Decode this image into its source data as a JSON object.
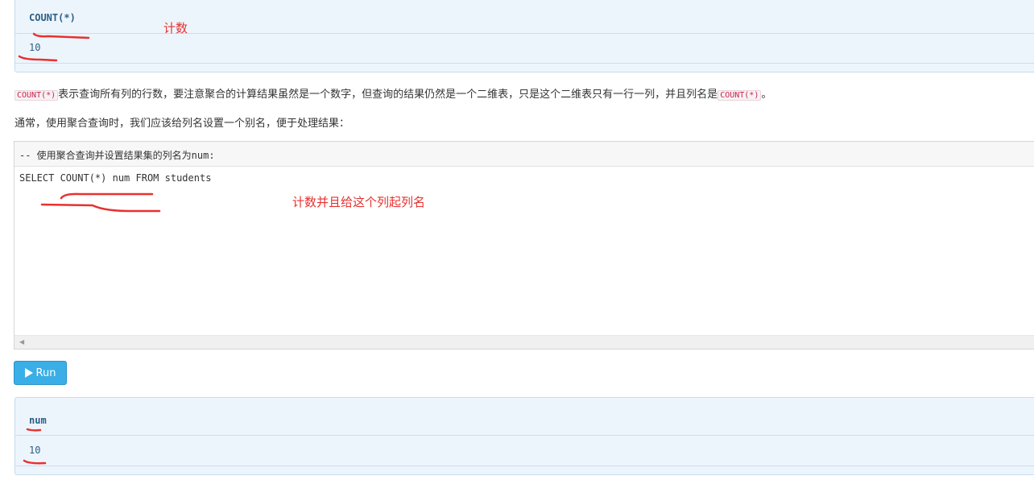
{
  "result_top": {
    "header": "COUNT(*)",
    "value": "10"
  },
  "paragraph1": {
    "code1": "COUNT(*)",
    "text": "表示查询所有列的行数，要注意聚合的计算结果虽然是一个数字，但查询的结果仍然是一个二维表，只是这个二维表只有一行一列，并且列名是",
    "code2": "COUNT(*)",
    "end": "。"
  },
  "paragraph2": {
    "text": "通常，使用聚合查询时，我们应该给列名设置一个别名，便于处理结果："
  },
  "editor": {
    "comment": "-- 使用聚合查询并设置结果集的列名为num:",
    "code": "SELECT COUNT(*) num FROM students"
  },
  "run_button": {
    "label": "Run"
  },
  "result_bottom": {
    "header": "num",
    "value": "10"
  },
  "annotations": {
    "count_note": "计数",
    "alias_note": "计数并且给这个列起列名"
  },
  "colors": {
    "accent": "#3aaee6",
    "annotation": "#e8312f",
    "code": "#c7254e"
  }
}
